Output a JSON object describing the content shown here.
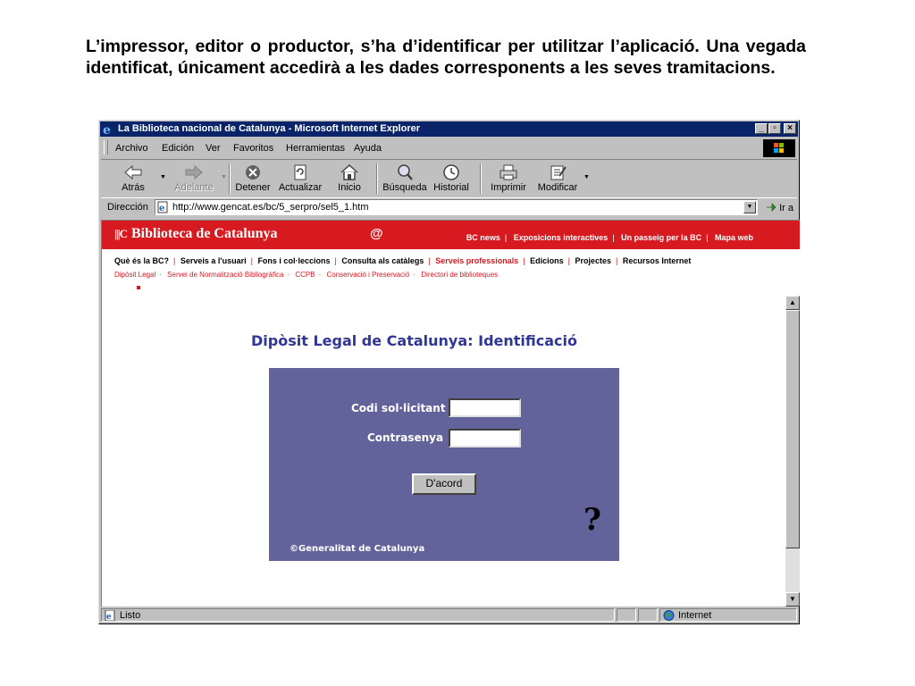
{
  "intro_text": "L’impressor, editor o productor, s’ha d’identificar per utilitzar l’aplicació. Una vegada identificat, únicament accedirà a les dades corresponents a les seves tramitacions.",
  "window": {
    "title": "La Biblioteca nacional de Catalunya - Microsoft Internet Explorer",
    "controls": [
      "minimize",
      "maximize",
      "close"
    ]
  },
  "menu": [
    "Archivo",
    "Edición",
    "Ver",
    "Favoritos",
    "Herramientas",
    "Ayuda"
  ],
  "toolbar": [
    {
      "label": "Atrás",
      "icon": "back-arrow-icon",
      "enabled": true
    },
    {
      "label": "Adelante",
      "icon": "forward-arrow-icon",
      "enabled": false
    },
    {
      "label": "Detener",
      "icon": "stop-icon",
      "enabled": true
    },
    {
      "label": "Actualizar",
      "icon": "refresh-icon",
      "enabled": true
    },
    {
      "label": "Inicio",
      "icon": "home-icon",
      "enabled": true
    },
    {
      "label": "Búsqueda",
      "icon": "search-icon",
      "enabled": true
    },
    {
      "label": "Historial",
      "icon": "history-icon",
      "enabled": true
    },
    {
      "label": "Imprimir",
      "icon": "print-icon",
      "enabled": true
    },
    {
      "label": "Modificar",
      "icon": "edit-icon",
      "enabled": true
    }
  ],
  "address": {
    "label": "Dirección",
    "url": "http://www.gencat.es/bc/5_serpro/sel5_1.htm",
    "go_label": "Ir a"
  },
  "site": {
    "brand": "Biblioteca de Catalunya",
    "at_symbol": "@",
    "top_links": [
      "BC news",
      "Exposicions interactives",
      "Un passeig per la BC",
      "Mapa web"
    ],
    "nav": [
      "Què és la BC?",
      "Serveis a l'usuari",
      "Fons i col·leccions",
      "Consulta als catàlegs",
      "Serveis professionals",
      "Edicions",
      "Projectes",
      "Recursos Internet"
    ],
    "nav_active": "Serveis professionals",
    "subnav": [
      "Dipòsit Legal",
      "Servei de Normalització Bibliogràfica",
      "CCPB",
      "Conservació i Preservació",
      "Directori de biblioteques"
    ],
    "heading": "Dipòsit Legal de Catalunya: Identificació",
    "form": {
      "code_label": "Codi sol·licitant",
      "code_value": "",
      "password_label": "Contrasenya",
      "password_value": "",
      "submit_label": "D'acord",
      "help_symbol": "?",
      "copyright": "©Generalitat de Catalunya"
    }
  },
  "status": {
    "text": "Listo",
    "zone": "Internet"
  },
  "colors": {
    "title_bar": "#0a246a",
    "site_red": "#d71920",
    "heading_blue": "#2f3694",
    "form_bg": "#63639b",
    "chrome": "#c0c0c0"
  }
}
